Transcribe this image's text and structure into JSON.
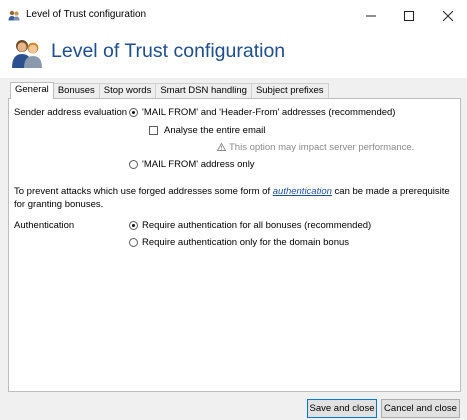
{
  "window": {
    "title": "Level of Trust configuration",
    "controls": {
      "minimize": "—",
      "maximize": "☐",
      "close": "✕"
    }
  },
  "header": {
    "title": "Level of Trust configuration"
  },
  "tabs": [
    {
      "label": "General",
      "active": true
    },
    {
      "label": "Bonuses",
      "active": false
    },
    {
      "label": "Stop words",
      "active": false
    },
    {
      "label": "Smart DSN handling",
      "active": false
    },
    {
      "label": "Subject prefixes",
      "active": false
    }
  ],
  "sender": {
    "label": "Sender address evaluation",
    "option1": "'MAIL FROM' and 'Header-From' addresses (recommended)",
    "option1_selected": true,
    "analyse": "Analyse the entire email",
    "analyse_checked": false,
    "warning_icon": "warning-icon",
    "warning": "This option may impact server performance.",
    "option2": "'MAIL FROM' address only",
    "option2_selected": false
  },
  "info": {
    "before": "To prevent attacks which use forged addresses some form of ",
    "link": "authentication",
    "after": " can be made a prerequisite for granting bonuses."
  },
  "auth": {
    "label": "Authentication",
    "option1": "Require authentication for all bonuses (recommended)",
    "option1_selected": true,
    "option2": "Require authentication only for the domain bonus",
    "option2_selected": false
  },
  "buttons": {
    "save": "Save and close",
    "cancel": "Cancel and close"
  },
  "colors": {
    "accent": "#1f4e8c",
    "link": "#1f4e9c",
    "focus": "#0078d7"
  }
}
